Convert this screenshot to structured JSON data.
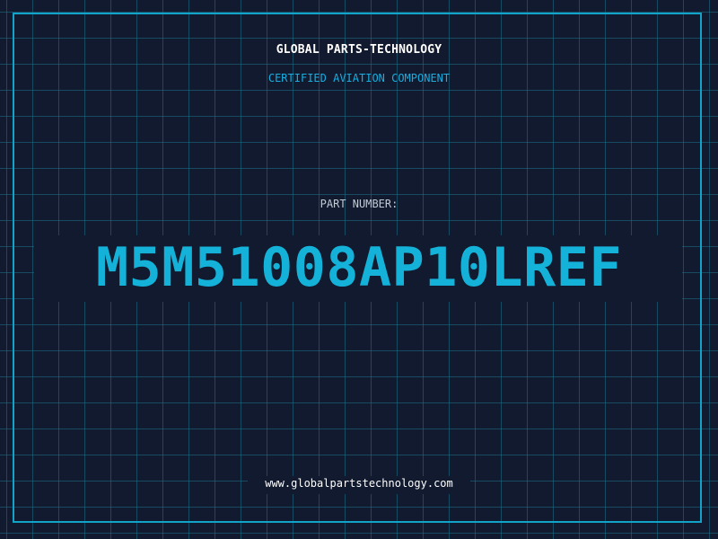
{
  "header": {
    "brand": "GLOBAL PARTS-TECHNOLOGY",
    "tagline": "CERTIFIED AVIATION COMPONENT"
  },
  "part": {
    "label": "PART NUMBER:",
    "number": "M5M51008AP10LREF"
  },
  "footer": {
    "url": "www.globalpartstechnology.com"
  },
  "colors": {
    "background": "#111a2e",
    "grid": "#1c708a",
    "accent": "#14b2d8",
    "frame": "#12a3c8",
    "text": "#ffffff"
  }
}
